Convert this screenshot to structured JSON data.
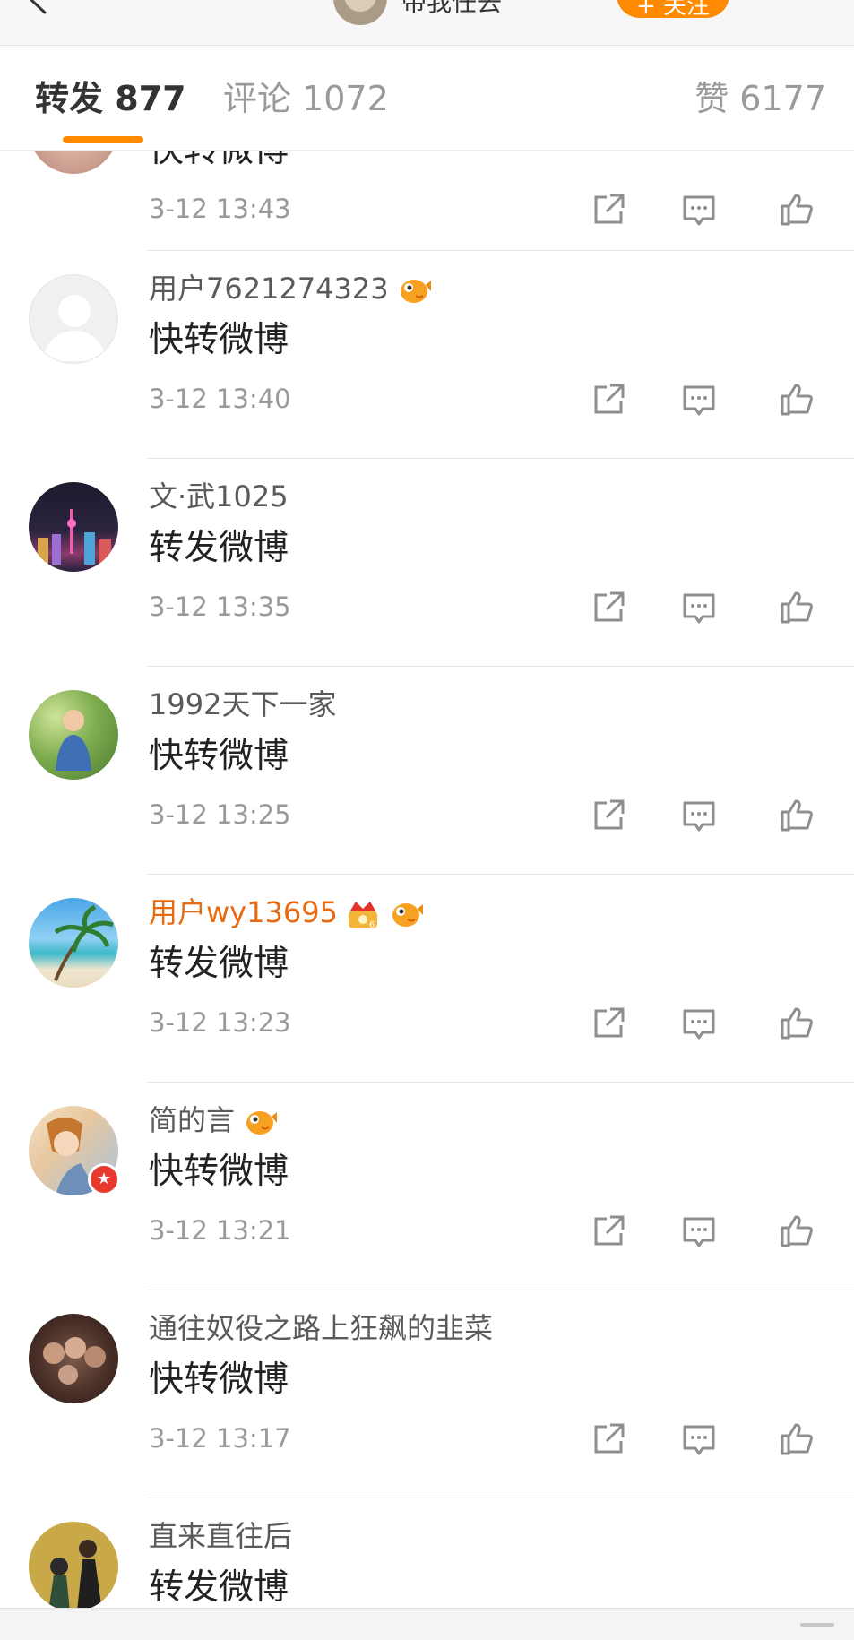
{
  "header": {
    "account_name": "带我任去",
    "follow_label": "+ 关注"
  },
  "tabs": {
    "repost": "转发 877",
    "comment": "评论 1072",
    "like": "赞 6177"
  },
  "colors": {
    "accent": "#ff8a00",
    "vip_name": "#e86a10",
    "muted": "#9a9a9a"
  },
  "partial_item": {
    "content": "快转微博",
    "time": "3-12 13:43"
  },
  "items": [
    {
      "username": "用户7621274323",
      "badges": [
        "fish-badge-icon"
      ],
      "content": "快转微博",
      "time": "3-12 13:40",
      "avatar": "default-avatar"
    },
    {
      "username": "文·武1025",
      "badges": [],
      "content": "转发微博",
      "time": "3-12 13:35",
      "avatar": "city-night-avatar"
    },
    {
      "username": "1992天下一家",
      "badges": [],
      "content": "快转微博",
      "time": "3-12 13:25",
      "avatar": "child-photo-avatar"
    },
    {
      "username": "用户wy13695",
      "badges": [
        "crown-vip-icon",
        "fish-badge-icon"
      ],
      "content": "转发微博",
      "time": "3-12 13:23",
      "avatar": "beach-palm-avatar",
      "vip": true
    },
    {
      "username": "简的言",
      "badges": [
        "fish-badge-icon"
      ],
      "content": "快转微博",
      "time": "3-12 13:21",
      "avatar": "illustration-avatar"
    },
    {
      "username": "通往奴役之路上狂飙的韭菜",
      "badges": [],
      "content": "快转微博",
      "time": "3-12 13:17",
      "avatar": "group-photo-avatar"
    },
    {
      "username": "直来直往后",
      "badges": [],
      "content": "转发微博",
      "time": "",
      "avatar": "poster-avatar"
    }
  ]
}
